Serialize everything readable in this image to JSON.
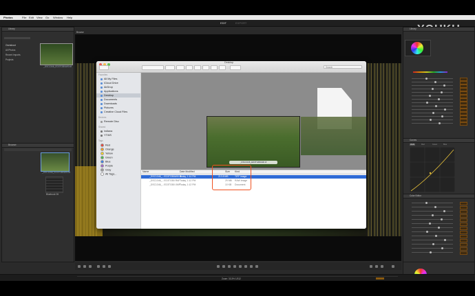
{
  "menubar": {
    "app": "Photos",
    "items": [
      "File",
      "Edit",
      "View",
      "Go",
      "Window",
      "Help"
    ]
  },
  "modes": {
    "edit": "EDIT",
    "export": "EXPORT"
  },
  "watermark": "YOUKU",
  "finder": {
    "title": "Desktop",
    "search_placeholder": "Search",
    "sidebar": {
      "favorites_header": "Favorites",
      "favorites": [
        "All My Files",
        "iCloud Drive",
        "AirDrop",
        "Applications",
        "Desktop",
        "Documents",
        "Downloads",
        "Pictures",
        "Creative Cloud Files"
      ],
      "devices_header": "Devices",
      "devices": [
        "Remote Disc"
      ],
      "shared_header": "Shared",
      "shared": [
        "indiana",
        "YTWS"
      ],
      "tags_header": "Tags",
      "tags": [
        {
          "label": "Red",
          "color": "#e8453c"
        },
        {
          "label": "Orange",
          "color": "#f39a1e"
        },
        {
          "label": "Yellow",
          "color": "#f5d226"
        },
        {
          "label": "Green",
          "color": "#47b94b"
        },
        {
          "label": "Blue",
          "color": "#3b82e6"
        },
        {
          "label": "Purple",
          "color": "#a066c9"
        },
        {
          "label": "Gray",
          "color": "#9b9b9b"
        },
        {
          "label": "All Tags...",
          "color": "#ffffff"
        }
      ]
    },
    "preview_caption": "_DSC1346_ED3TGB0A90.tif",
    "columns": {
      "name": "Name",
      "date": "Date Modified",
      "size": "Size",
      "kind": "Kind"
    },
    "files": [
      {
        "name": "_DSC1346_...ED3TGB0A90.tif",
        "date": "Today, 1:14 PM",
        "size": "213.8 MB",
        "kind": "TIFF image",
        "selected": true
      },
      {
        "name": "_DSC1346_...ED3TGB0.RAF",
        "date": "Today, 1:12 PM",
        "size": "29 MB",
        "kind": "RAW Image"
      },
      {
        "name": "_DSC1346_...ED3TGB0.XMP",
        "date": "Today, 1:12 PM",
        "size": "10 KB",
        "kind": "Document"
      }
    ]
  },
  "left_panel": {
    "library_header": "Library",
    "folders": [
      "Overshoot",
      "All Photos",
      "Recent Imports",
      "Projects"
    ],
    "thumb_caption": "_DSC1346_ED3TGB0A90.tif",
    "browser_header": "Browser",
    "browser_thumbs": [
      "_DSC1346_ED3TGB0A90.tif",
      "Bluebook Oil"
    ]
  },
  "right_panel": {
    "library_label": "Library",
    "sections": [
      "Color Balance",
      "Levels",
      "Curves",
      "Color Editor",
      "Local Adjustments",
      "Sharpening",
      "Noise Reduction"
    ],
    "curve_tabs": [
      "RGB",
      "Red",
      "Green",
      "Blue"
    ]
  },
  "viewer": {
    "top_label": "Browse"
  },
  "status": {
    "center": "Zoom: 33.3%  1/312"
  }
}
